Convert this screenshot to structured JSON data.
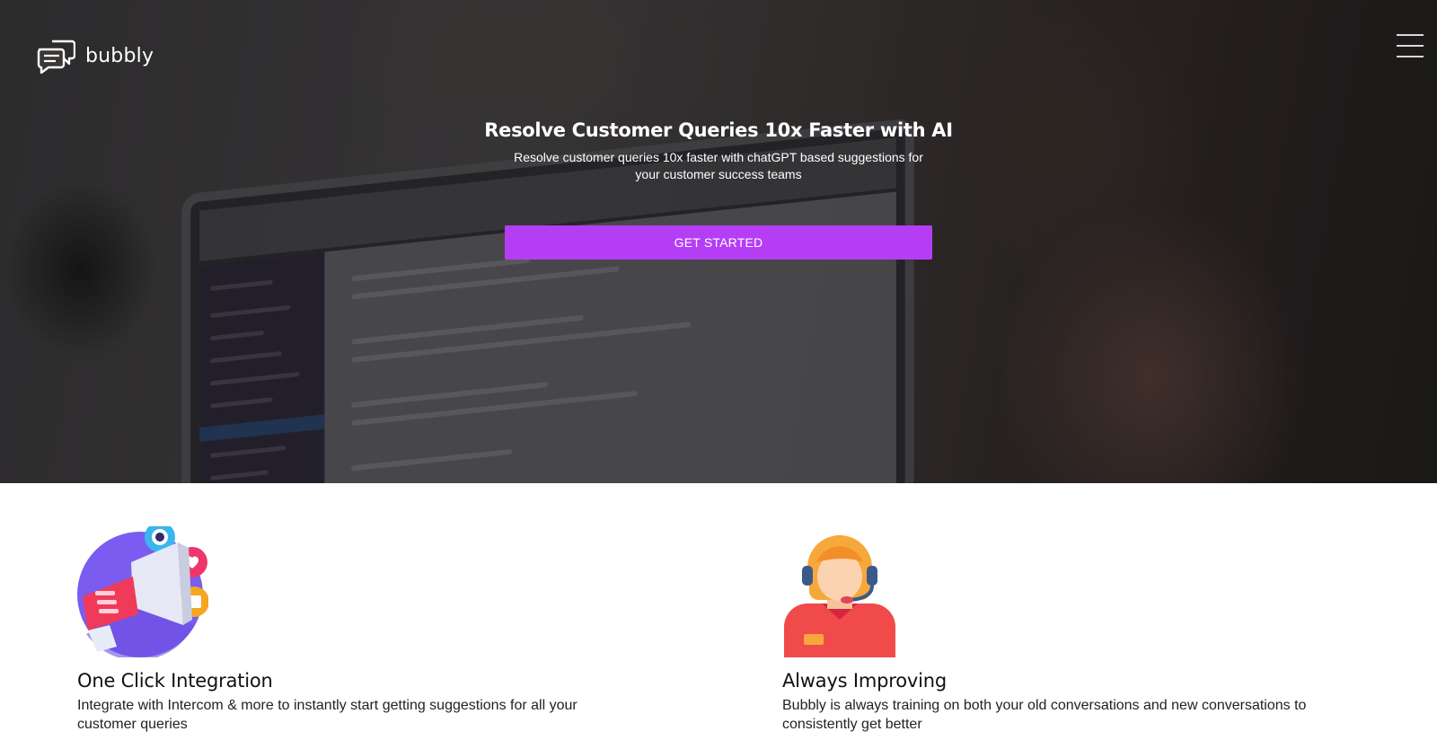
{
  "brand": {
    "name": "bubbly",
    "logo_icon": "chat-bubbles-icon"
  },
  "nav": {
    "menu_icon": "hamburger-menu-icon"
  },
  "hero": {
    "title": "Resolve Customer Queries 10x Faster with AI",
    "subtitle": "Resolve customer queries 10x faster with chatGPT based suggestions for your customer success teams",
    "cta_label": "GET STARTED",
    "cta_color": "#b53ef5"
  },
  "features": [
    {
      "icon": "megaphone-icon",
      "title": "One Click Integration",
      "description": "Integrate with Intercom & more to instantly start getting suggestions for all your customer queries"
    },
    {
      "icon": "support-agent-icon",
      "title": "Always Improving",
      "description": "Bubbly is always training on both your old conversations and new conversations to consistently get better"
    }
  ]
}
